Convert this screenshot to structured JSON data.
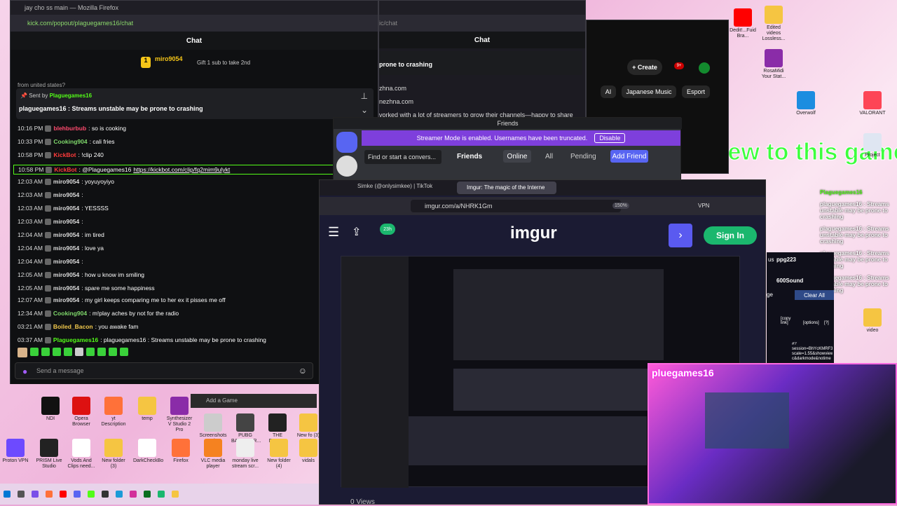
{
  "colors": {
    "kick_green": "#53fc18",
    "discord_purple": "#5865f2",
    "imgur_bg": "#1b1b33",
    "pink": "#f0b6dc"
  },
  "firefox_left": {
    "title": "jay cho ss main — Mozilla Firefox",
    "url": "kick.com/popout/plaguegames16/chat",
    "chat_title": "Chat",
    "gift_user": "miro9054",
    "gift_count": "1",
    "gift_text": "Gift 1 sub to take 2nd",
    "cut_text": "from united states?",
    "pinned_sent_by": "Sent by",
    "pinned_user": "Plaguegames16",
    "pinned_message": "plaguegames16 : Streams unstable may be prone to crashing",
    "messages": [
      {
        "time": "10:16 PM",
        "user": "blehburbub",
        "text": ": so is cooking",
        "color": "#ff4a6e"
      },
      {
        "time": "10:33 PM",
        "user": "Cooking904",
        "text": ": cali fries",
        "color": "#7fd86b"
      },
      {
        "time": "10:58 PM",
        "user": "KickBot",
        "text": ": !clip 240",
        "color": "#ff3b3b"
      },
      {
        "time": "10:58 PM",
        "user": "KickBot",
        "text": ": @Plaguegames16 ",
        "link": "https://kickbot.com/clip/fq2mim9ulykt",
        "color": "#ff3b3b"
      },
      {
        "time": "12:03 AM",
        "user": "miro9054",
        "text": ": yoyuyoyiyo",
        "color": "#dddddd"
      },
      {
        "time": "12:03 AM",
        "user": "miro9054",
        "text": ":",
        "color": "#dddddd"
      },
      {
        "time": "12:03 AM",
        "user": "miro9054",
        "text": ": YESSSS",
        "color": "#dddddd"
      },
      {
        "time": "12:03 AM",
        "user": "miro9054",
        "text": ":",
        "color": "#dddddd"
      },
      {
        "time": "12:04 AM",
        "user": "miro9054",
        "text": ": im tired",
        "color": "#dddddd"
      },
      {
        "time": "12:04 AM",
        "user": "miro9054",
        "text": ": love ya",
        "color": "#dddddd"
      },
      {
        "time": "12:04 AM",
        "user": "miro9054",
        "text": ":",
        "color": "#dddddd"
      },
      {
        "time": "12:05 AM",
        "user": "miro9054",
        "text": ": how u know im smiling",
        "color": "#dddddd"
      },
      {
        "time": "12:05 AM",
        "user": "miro9054",
        "text": ": spare me some happiness",
        "color": "#dddddd"
      },
      {
        "time": "12:07 AM",
        "user": "miro9054",
        "text": ": my girl keeps comparing me to her ex it pisses me off",
        "color": "#dddddd"
      },
      {
        "time": "12:34 AM",
        "user": "Cooking904",
        "text": ": m!play aches by not for the radio",
        "color": "#7fd86b"
      },
      {
        "time": "03:21 AM",
        "user": "Boiled_Bacon",
        "text": ": you awake fam",
        "color": "#f2c94c"
      },
      {
        "time": "03:37 AM",
        "user": "Plaguegames16",
        "text": ": plaguegames16 : Streams unstable may be prone to crashing",
        "color": "#53fc18"
      }
    ],
    "send_placeholder": "Send a message"
  },
  "firefox_mid": {
    "chat_title": "Chat",
    "pinned": "prone to crashing",
    "line1": "zhna.com",
    "line2": "nezhna.com",
    "line3": "vorked with a lot of streamers to grow their channels—happy to share"
  },
  "browser_right": {
    "create": "Create",
    "badge": "9+",
    "chips": [
      "AI",
      "Japanese Music",
      "Esport"
    ]
  },
  "discord": {
    "title": "Friends",
    "banner": "Streamer Mode is enabled. Usernames have been truncated.",
    "disable": "Disable",
    "search": "Find or start a convers...",
    "tabs": [
      "Friends",
      "Online",
      "All",
      "Pending",
      "Add Friend"
    ]
  },
  "imgur": {
    "tab1": "Simke (@onlysimkee) | TikTok",
    "tab2": "Imgur: The magic of the Interne",
    "url": "imgur.com/a/NHRK1Gm",
    "zoom": "150%",
    "vpn": "VPN",
    "logo": "imgur",
    "signin": "Sign In",
    "badge": "23h",
    "views": "0 Views"
  },
  "overlay": {
    "big_text": "New to this game",
    "chat_lines": [
      "plaguegames16 : Streams unstable may be prone to crashing",
      "plaguegames16 : Streams unstable may be prone to crashing",
      "plaguegames16 : Streams unstable may be prone to crashing",
      "plaguegames16 : Streams unstable may be prone to crashing"
    ],
    "user1": "Plaguegames16",
    "user2": "plaguegames16",
    "cam_name": "pluegames16",
    "clear_all": "Clear All",
    "copy_link": "[copy link]",
    "options": "[options]",
    "q": "[?]",
    "session": "#?session=BhYcKMRF3 scale=1.55&showviewer c&darkmode&notime",
    "us": "us",
    "user_a": "ppg223",
    "user_b": "600Sound",
    "ge": "ge"
  },
  "desktop_icons": [
    "NDI",
    "Opera Browser",
    "yt Description",
    "temp",
    "Synthesizer V Studio 2 Pro",
    "Screenshots mk",
    "PUBG BATTLEGR...",
    "THE FINALS",
    "New fo (3)",
    "Proton VPN",
    "PRISM Live Studio",
    "Vods And Clips need...",
    "New folder (3)",
    "DarkCheckBo",
    "Firefox",
    "VLC media player",
    "monday live stream scr...",
    "New folder (4)",
    "vidals"
  ],
  "top_icons": [
    "Edited videos Lossless...",
    "Dedit!...Fuid Bra...",
    "VALORANT",
    "Overwolf",
    "RosaMidi Your Stat...",
    "Project",
    "video"
  ],
  "add_game": "Add a Game"
}
